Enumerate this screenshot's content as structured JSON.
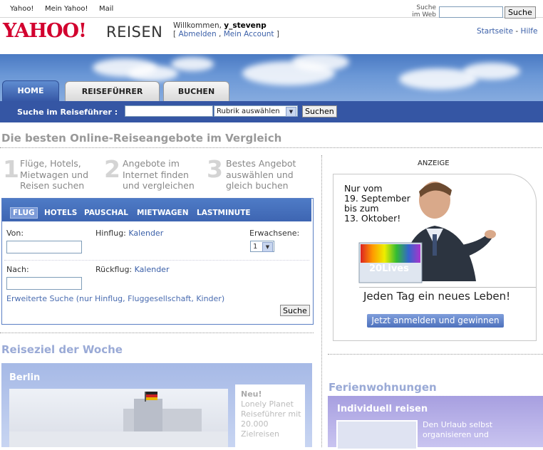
{
  "topbar": {
    "links": [
      "Yahoo!",
      "Mein Yahoo!",
      "Mail"
    ],
    "search_label_line1": "Suche",
    "search_label_line2": "im Web",
    "search_button": "Suche"
  },
  "header": {
    "logo": "YAHOO!",
    "logo_section": "REISEN",
    "welcome_prefix": "Willkommen,",
    "username": "y_stevenp",
    "logout": "Abmelden",
    "account": "Mein Account",
    "home_link": "Startseite",
    "help_link": "Hilfe"
  },
  "nav": {
    "tabs": [
      "HOME",
      "REISEFÜHRER",
      "BUCHEN"
    ],
    "active_tab": "HOME"
  },
  "guide_search": {
    "label": "Suche im Reiseführer :",
    "select_value": "Rubrik auswählen",
    "button": "Suchen"
  },
  "main": {
    "heading": "Die besten Online-Reiseangebote im Vergleich",
    "steps": [
      {
        "num": "1",
        "lines": [
          "Flüge, Hotels,",
          "Mietwagen und",
          "Reisen suchen"
        ]
      },
      {
        "num": "2",
        "lines": [
          "Angebote im",
          "Internet finden",
          "und vergleichen"
        ]
      },
      {
        "num": "3",
        "lines": [
          "Bestes Angebot",
          "auswählen und",
          "gleich buchen"
        ]
      }
    ]
  },
  "flight_search": {
    "tabs": [
      "FLUG",
      "HOTELS",
      "PAUSCHAL",
      "MIETWAGEN",
      "LASTMINUTE"
    ],
    "active_tab": "FLUG",
    "from_label": "Von:",
    "to_label": "Nach:",
    "depart_label": "Hinflug:",
    "return_label": "Rückflug:",
    "calendar_link": "Kalender",
    "adults_label": "Erwachsene:",
    "adults_value": "1",
    "advanced_link": "Erweiterte Suche (nur Hinflug, Fluggesellschaft, Kinder)",
    "submit": "Suche"
  },
  "destination": {
    "heading": "Reiseziel der Woche",
    "city": "Berlin",
    "new_label": "Neu!",
    "text": "Lonely Planet Reiseführer mit 20.000 Zielreisen"
  },
  "ad": {
    "label": "ANZEIGE",
    "dates": [
      "Nur vom",
      "19. September",
      "bis zum",
      "13. Oktober!"
    ],
    "product": "20Lives",
    "slogan": "Jeden Tag ein neues Leben!",
    "cta": "Jetzt anmelden und gewinnen"
  },
  "ferienwohnungen": {
    "heading": "Ferienwohnungen",
    "title": "Individuell reisen",
    "text": "Den Urlaub selbst organisieren und"
  }
}
